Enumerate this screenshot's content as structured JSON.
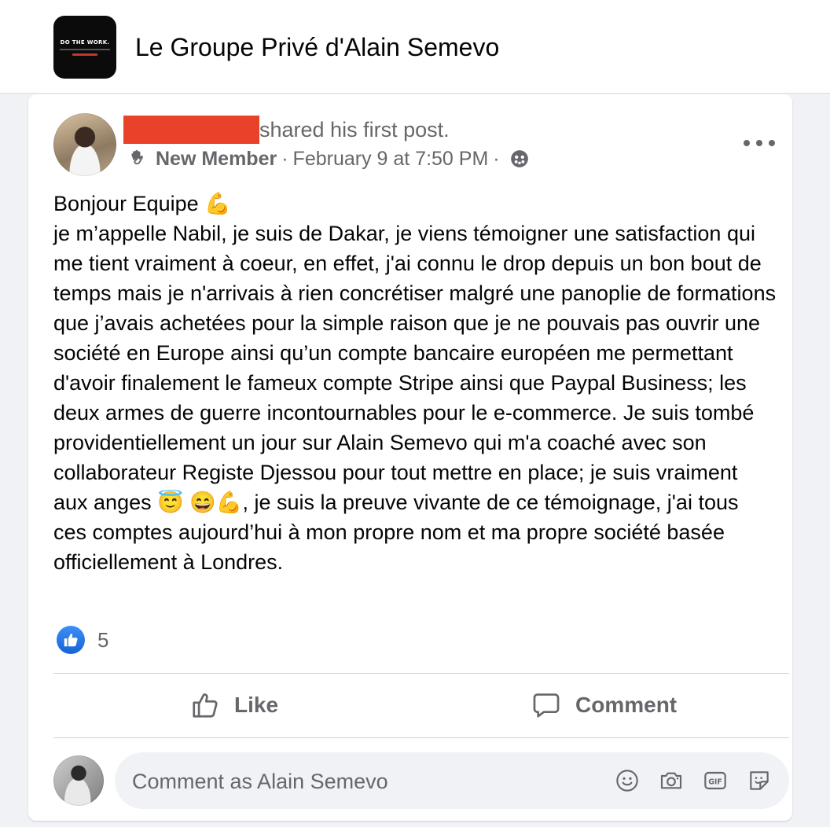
{
  "group": {
    "logo_text": "DO THE WORK.",
    "title": "Le Groupe Privé d'Alain Semevo"
  },
  "post": {
    "author_redacted": true,
    "shared_text": "shared his first post.",
    "badge": "New Member",
    "date": "February 9 at 7:50 PM",
    "separator": "·",
    "body": "Bonjour Equipe 💪\nje m’appelle Nabil, je suis de Dakar, je viens témoigner une satisfaction qui me tient vraiment à coeur, en effet, j'ai connu le drop depuis un bon bout de temps mais je n'arrivais à rien concrétiser malgré une panoplie de formations que j’avais achetées pour la simple raison que je ne pouvais pas ouvrir une société en Europe ainsi qu’un compte bancaire européen me permettant d'avoir finalement le fameux compte Stripe ainsi que Paypal Business; les deux armes de guerre incontournables pour le e-commerce. Je suis tombé providentiellement un jour sur Alain Semevo qui m'a coaché avec son collaborateur Registe Djessou pour tout mettre en place; je suis vraiment aux anges 😇 😄💪, je suis la preuve vivante de ce témoignage, j'ai tous ces comptes aujourd’hui à mon propre nom et ma propre société basée officiellement à Londres.",
    "reaction_count": "5"
  },
  "actions": {
    "like_label": "Like",
    "comment_label": "Comment"
  },
  "comment_box": {
    "placeholder": "Comment as Alain Semevo"
  },
  "icons": [
    "wave-icon",
    "globe-icon",
    "more-icon",
    "like-reaction-icon",
    "like-icon",
    "comment-icon",
    "emoji-icon",
    "camera-icon",
    "gif-icon",
    "sticker-icon"
  ],
  "colors": {
    "accent_blue": "#1877f2",
    "secondary_text": "#65676b",
    "redaction": "#e8422a",
    "background": "#f0f2f5"
  }
}
